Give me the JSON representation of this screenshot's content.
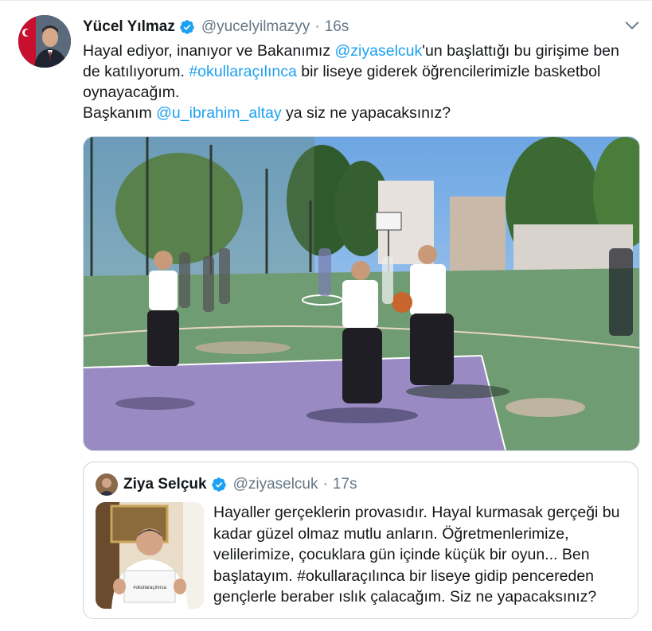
{
  "tweet": {
    "author_name": "Yücel Yılmaz",
    "author_handle": "@yucelyilmazyy",
    "separator": "·",
    "timestamp": "16s",
    "text_line1_pre": "Hayal ediyor, inanıyor ve Bakanımız ",
    "mention1": "@ziyaselcuk",
    "text_line1_post": "'un başlattığı bu girişime ben de katılıyorum. ",
    "hashtag": "#okullaraçılınca",
    "text_line2_post": " bir liseye giderek öğrencilerimizle basketbol oynayacağım.",
    "text_line3_pre": "Başkanım ",
    "mention2": "@u_ibrahim_altay",
    "text_line3_post": " ya siz ne yapacaksınız?"
  },
  "quoted_tweet": {
    "author_name": "Ziya Selçuk",
    "author_handle": "@ziyaselcuk",
    "separator": "·",
    "timestamp": "17s",
    "text": "Hayaller gerçeklerin provasıdır. Hayal kurmasak gerçeği bu kadar güzel olmaz mutlu anların. Öğretmenlerimize, velilerimize, çocuklara gün içinde küçük bir oyun... Ben başlatayım. #okullaraçılınca bir liseye gidip pencereden gençlerle beraber ıslık çalacağım. Siz ne yapacaksınız?",
    "sign_text": "#okullaraçılınca"
  },
  "icons": {
    "verified": "verified-badge-icon",
    "menu": "chevron-down-icon"
  },
  "colors": {
    "link": "#1da1f2",
    "secondary_text": "#657786",
    "border": "#ccd6dd"
  }
}
